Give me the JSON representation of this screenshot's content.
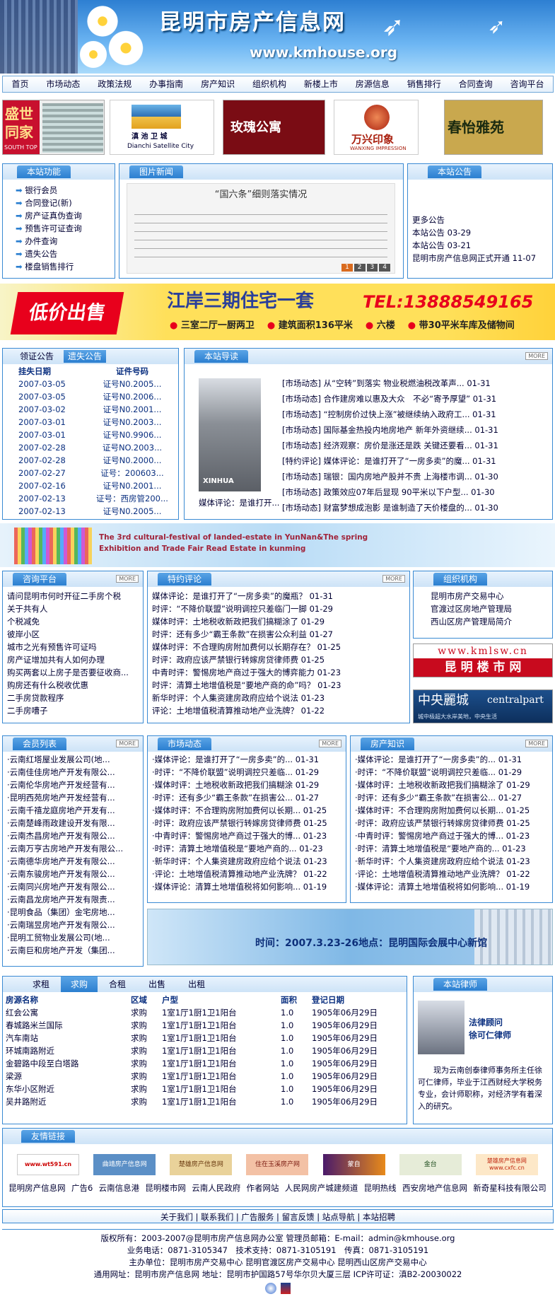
{
  "header": {
    "title": "昆明市房产信息网",
    "url": "www.kmhouse.org"
  },
  "nav": [
    "首页",
    "市场动态",
    "政策法规",
    "办事指南",
    "房产知识",
    "组织机构",
    "新楼上市",
    "房源信息",
    "销售排行",
    "合同查询",
    "咨询平台"
  ],
  "ads": [
    "盛世同家",
    "滇池卫城 Dianchi Satellite City",
    "玫瑰公寓",
    "万兴印象",
    "春怡雅苑"
  ],
  "ad_extra": {
    "a1": "SOUTH TOP",
    "a3": "玫瑰公寓",
    "a4": "WANXING IMPRESSION",
    "a5": "春怡雅苑",
    "a2a": "滇 池 卫 城",
    "a2b": "Dianchi Satellite City"
  },
  "functions": {
    "title": "本站功能",
    "items": [
      "银行会员",
      "合同登记(新)",
      "房产证真伪查询",
      "预售许可证查询",
      "办件查询",
      "遗失公告",
      "楼盘销售排行"
    ]
  },
  "picnews": {
    "title": "图片新闻",
    "caption": "“国六条”细则落实情况",
    "pages": [
      "1",
      "2",
      "3",
      "4"
    ]
  },
  "notice": {
    "title": "本站公告",
    "items": [
      "更多公告",
      "本站公告 03-29",
      "本站公告 03-21",
      "昆明市房产信息网正式开通 11-07"
    ]
  },
  "promo": {
    "tag": "低价出售",
    "main": "江岸三期住宅一套",
    "tel": "TEL:13888549165",
    "details": [
      "三室二厅一厨两卫",
      "建筑面积136平米",
      "六楼",
      "带30平米车库及储物间"
    ]
  },
  "certs": {
    "tabs": [
      "领证公告",
      "遗失公告"
    ],
    "headers": [
      "挂失日期",
      "证件号码"
    ],
    "rows": [
      [
        "2007-03-05",
        "证号N0.2005..."
      ],
      [
        "2007-03-05",
        "证号N0.2006..."
      ],
      [
        "2007-03-02",
        "证号N0.2001..."
      ],
      [
        "2007-03-01",
        "证号N0.2003..."
      ],
      [
        "2007-03-01",
        "证号N0.9906..."
      ],
      [
        "2007-02-28",
        "证号NO.2003..."
      ],
      [
        "2007-02-28",
        "证号N0.2000..."
      ],
      [
        "2007-02-27",
        "证号：200603..."
      ],
      [
        "2007-02-16",
        "证号N0.2001..."
      ],
      [
        "2007-02-13",
        "证号：西房管200..."
      ],
      [
        "2007-02-13",
        "证号N0.2005..."
      ]
    ]
  },
  "guide": {
    "title": "本站导读",
    "more": "MORE",
    "img_text": "XINHUA",
    "img_caption": "媒体评论：是谁打开...",
    "items": [
      "[市场动态] 从“空转”到落实 物业税燃油税改革声... 01-31",
      "[市场动态] 合作建房难以惠及大众　不必“寄予厚望” 01-31",
      "[市场动态] “控制房价过快上涨”被继续纳入政府工... 01-31",
      "[市场动态] 国际基金热投内地房地产 新年外资继续... 01-31",
      "[市场动态] 经济观察：房价是涨还是跌 关键还要看... 01-31",
      "[特约评论] 媒体评论：是谁打开了“一房多卖”的魔... 01-31",
      "[市场动态] 瑞银：国内房地产股并不贵 上海楼市调... 01-30",
      "[市场动态] 政策效应07年后显现 90平米以下户型... 01-30",
      "[市场动态] 财富梦想成泡影 是谁制造了天价楼盘的... 01-30"
    ]
  },
  "festival": {
    "line1": "The 3rd cultural-festival of landed-estate in YunNan&The spring",
    "line2": "Exhibition and Trade Fair Read Estate in kunming"
  },
  "consult": {
    "title": "咨询平台",
    "more": "MORE",
    "items": [
      "请问昆明市何时开征二手房个税",
      "关于共有人",
      "个税减免",
      "彼岸小区",
      "城市之光有预售许可证吗",
      "房产证增加共有人如何办理",
      "购买两套以上房子是否要征收商...",
      "购房还有什么税收优惠",
      "二手房贷款程序",
      "二手房嘈子"
    ]
  },
  "comment": {
    "title": "特约评论",
    "more": "MORE",
    "items": [
      "媒体评论：是谁打开了“一房多卖”的魔瓶？ 01-31",
      "时评：“不降价联盟”说明调控只差临门一脚 01-29",
      "媒体时评：土地税收新政把我们搞糊涂了 01-29",
      "时评：还有多少“霸王条款”在损害公众利益 01-27",
      "媒体时评：不合理购房附加费何以长期存在？ 01-25",
      "时评：政府应该严禁银行转嫁房贷律师费 01-25",
      "中青时评：警惕房地产商过于强大的博弈能力 01-23",
      "时评：清算土地增值税是“要地产商的命”吗？ 01-23",
      "新华时评：个人集资建房政府应给个说法 01-23",
      "评论：土地增值税清算推动地产业洗牌？ 01-22"
    ]
  },
  "org": {
    "title": "组织机构",
    "items": [
      "昆明市房产交易中心",
      "官渡过区房地产管理局",
      "西山区房产管理局简介"
    ],
    "ad1_top": "www.kmlsw.cn",
    "ad1_bottom": "昆 明 楼 市 网",
    "ad2_left": "中央麗城",
    "ad2_right": "centralpart",
    "ad2_sub": "城中极超大水岸美地，中央生活"
  },
  "members": {
    "title": "会员列表",
    "more": "MORE",
    "items": [
      "·云南红塔屋业发展公司(地...",
      "·云南佳佳房地产开发有限公...",
      "·云南伦华房地产开发经营有...",
      "·昆明西苑房地产开发经营有...",
      "·云南千禧龙庭房地产开发有...",
      "·云南楚峰雨政建设开发有限...",
      "·云南杰昌房地产开发有限公...",
      "·云南万亨古房地产开发有限公...",
      "·云南德华房地产开发有限公...",
      "·云南东骏房地产开发有限公...",
      "·云南同兴房地产开发有限公...",
      "·云南昌龙房地产开发有限责...",
      "·昆明食品（集团）金宅房地...",
      "·云南瑞昱房地产开发有限公...",
      "·昆明工贸物业发展公司(地...",
      "·云南巨和房地产开发（集团..."
    ]
  },
  "market": {
    "title": "市场动态",
    "more": "MORE",
    "items": [
      "·媒体评论：是谁打开了“一房多卖”的... 01-31",
      "·时评：“不降价联盟”说明调控只差临... 01-29",
      "·媒体时评：土地税收新政把我们搞糊涂 01-29",
      "·时评：还有多少“霸王条款”在损害公... 01-27",
      "·媒体时评：不合理购房附加费何以长期... 01-25",
      "·时评：政府应该严禁银行转嫁房贷律师费 01-25",
      "·中青时评：警惕房地产商过于强大的博... 01-23",
      "·时评：清算土地增值税是“要地产商的... 01-23",
      "·新华时评：个人集资建房政府应给个说法 01-23",
      "·评论：土地增值税清算推动地产业洗牌？ 01-22",
      "·媒体评论：清算土地增值税将如何影响... 01-19"
    ]
  },
  "knowledge": {
    "title": "房产知识",
    "more": "MORE",
    "items": [
      "·媒体评论：是谁打开了“一房多卖”的... 01-31",
      "·时评：“不降价联盟”说明调控只差临... 01-29",
      "·媒体时评：土地税收新政把我们搞糊涂了 01-29",
      "·时评：还有多少“霸王条款”在损害公... 01-27",
      "·媒体时评：不合理购房附加费何以长期... 01-25",
      "·时评：政府应该严禁银行转嫁房贷律师费 01-25",
      "·中青时评：警惕房地产商过于强大的博... 01-23",
      "·时评：清算土地增值税是“要地产商的... 01-23",
      "·新华时评：个人集资建房政府应给个说法 01-23",
      "·评论：土地增值税清算推动地产业洗牌？ 01-22",
      "·媒体评论：清算土地增值税将如何影响... 01-19"
    ]
  },
  "expo": {
    "text": "时间：2007.3.23-26地点：昆明国际会展中心新馆"
  },
  "listing": {
    "tabs": [
      "求租",
      "求购",
      "合租",
      "出售",
      "出租"
    ],
    "headers": [
      "房源名称",
      "区域",
      "户型",
      "面积",
      "登记日期"
    ],
    "rows": [
      [
        "红会公寓",
        "求购",
        "1室1厅1厨1卫1阳台",
        "1.0",
        "1905年06月29日"
      ],
      [
        "春城路米兰国际",
        "求购",
        "1室1厅1厨1卫1阳台",
        "1.0",
        "1905年06月29日"
      ],
      [
        "汽车南站",
        "求购",
        "1室1厅1厨1卫1阳台",
        "1.0",
        "1905年06月29日"
      ],
      [
        "环城南路附近",
        "求购",
        "1室1厅1厨1卫1阳台",
        "1.0",
        "1905年06月29日"
      ],
      [
        "金碧路中段至白塔路",
        "求购",
        "1室1厅1厨1卫1阳台",
        "1.0",
        "1905年06月29日"
      ],
      [
        "梁源",
        "求购",
        "1室1厅1厨1卫1阳台",
        "1.0",
        "1905年06月29日"
      ],
      [
        "东华小区附近",
        "求购",
        "1室1厅1厨1卫1阳台",
        "1.0",
        "1905年06月29日"
      ],
      [
        "吴井路附近",
        "求购",
        "1室1厅1厨1卫1阳台",
        "1.0",
        "1905年06月29日"
      ]
    ]
  },
  "lawyer": {
    "title": "本站律师",
    "role": "法律顾问",
    "name": "徐可仁律师",
    "bio": "现为云南创泰律师事务所主任徐可仁律师，毕业于江西财经大学税务专业，会计师职称，对经济学有着深入的研究。"
  },
  "links": {
    "title": "友情链接",
    "logos": [
      "www.wt591.cn",
      "曲靖房产信息网",
      "楚雄房产信息网",
      "住在玉溪房产网",
      "蒙自",
      "金台",
      "楚雄房产信息网 www.cxfc.cn"
    ],
    "text": [
      "昆明房产信息网",
      "广告6",
      "云南信息港",
      "昆明楼市网",
      "云南人民政府",
      "作者网站",
      "人民网房产城建频道",
      "昆明热线",
      "西安房地产信息网",
      "新奇星科技有限公司"
    ]
  },
  "footer": {
    "links": "关于我们 | 联系我们 | 广告服务 | 留言反馈 | 站点导航 | 本站招聘",
    "lines": [
      "版权所有：2003-2007@昆明市房产信息网办公室 管理员邮箱：E-mail：admin@kmhouse.org",
      "业务电话：0871-3105347　技术支持：0871-3105191　传真：0871-3105191",
      "主办单位：昆明市房产交易中心 昆明官渡区房产交易中心 昆明西山区房产交易中心",
      "通用网址：昆明市房产信息网 地址：昆明市护国路57号华尔贝大厦三层 ICP许可证：滇B2-20030022"
    ]
  },
  "colors": {
    "accent": "#2b7fd0",
    "border": "#3a8ad3",
    "promo_bg": "#ffe05a",
    "promo_tag": "#e8001c"
  }
}
